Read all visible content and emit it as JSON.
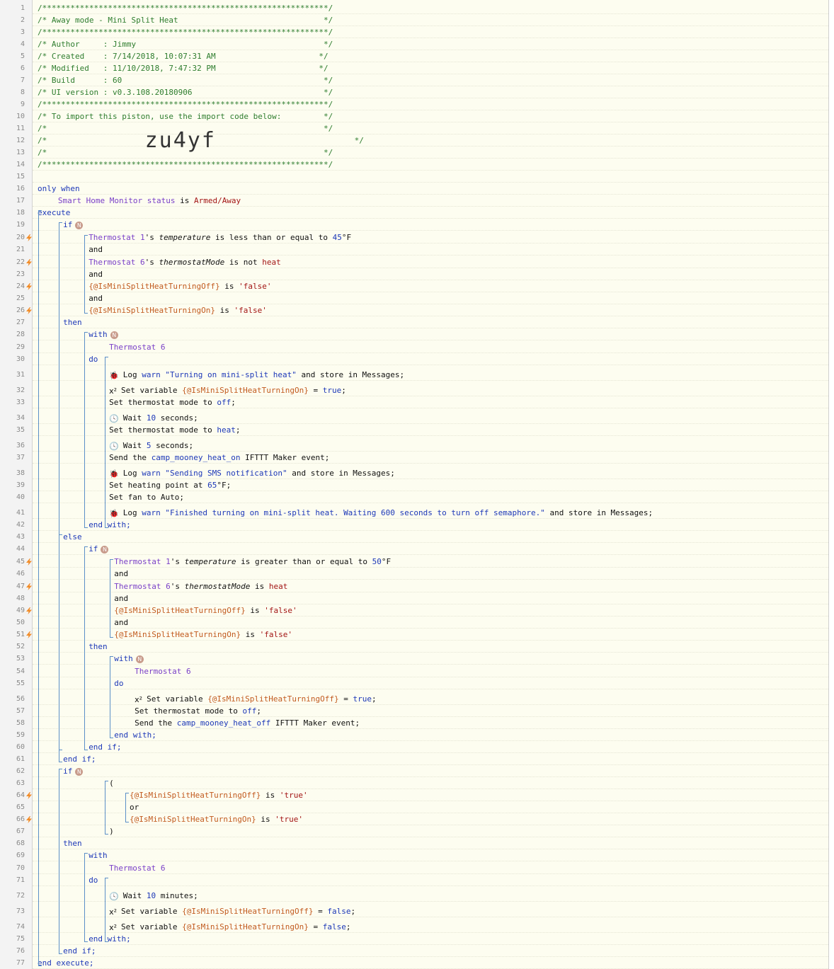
{
  "header": {
    "stars": "/*************************************************************/",
    "title": "/* Away mode - Mini Split Heat                               */",
    "author": "/* Author     : Jimmy                                        */",
    "created": "/* Created    : 7/14/2018, 10:07:31 AM                      */",
    "modified": "/* Modified   : 11/10/2018, 7:47:32 PM                      */",
    "build": "/* Build      : 60                                           */",
    "ui_version": "/* UI version : v0.3.108.20180906                            */",
    "import_text": "/* To import this piston, use the import code below:         */",
    "blank": "/*                                                           */",
    "left_cmt": "/*",
    "right_cmt": "*/",
    "import_code": "zu4yf"
  },
  "line_numbers": [
    "1",
    "2",
    "3",
    "4",
    "5",
    "6",
    "7",
    "8",
    "9",
    "10",
    "11",
    "12",
    "13",
    "14",
    "15",
    "16",
    "17",
    "18",
    "19",
    "20",
    "21",
    "22",
    "23",
    "24",
    "25",
    "26",
    "27",
    "28",
    "29",
    "30",
    "31",
    "32",
    "33",
    "34",
    "35",
    "36",
    "37",
    "38",
    "39",
    "40",
    "41",
    "42",
    "43",
    "44",
    "45",
    "46",
    "47",
    "48",
    "49",
    "50",
    "51",
    "52",
    "53",
    "54",
    "55",
    "56",
    "57",
    "58",
    "59",
    "60",
    "61",
    "62",
    "63",
    "64",
    "65",
    "66",
    "67",
    "68",
    "69",
    "70",
    "71",
    "72",
    "73",
    "74",
    "75",
    "76",
    "77"
  ],
  "kw": {
    "only_when": "only when",
    "execute": "execute",
    "if": "if",
    "then": "then",
    "with": "with",
    "do": "do",
    "else": "else",
    "and": "and",
    "or": "or",
    "end_with": "end with;",
    "end_if": "end if;",
    "end_execute": "end execute;",
    "badge": "N",
    "lparen": "(",
    "rparen": ")"
  },
  "s17": {
    "dev": "Smart Home Monitor status",
    "is": " is ",
    "val": "Armed/Away"
  },
  "s20": {
    "dev": "Thermostat 1",
    "a": "'s ",
    "attr": "temperature",
    "b": " is less than or equal to ",
    "num": "45",
    "unit": "°F"
  },
  "s22": {
    "dev": "Thermostat 6",
    "a": "'s ",
    "attr": "thermostatMode",
    "b": " is not ",
    "val": "heat"
  },
  "s24": {
    "var": "{@IsMiniSplitHeatTurningOff}",
    "b": " is ",
    "val": "'false'"
  },
  "s26": {
    "var": "{@IsMiniSplitHeatTurningOn}",
    "b": " is ",
    "val": "'false'"
  },
  "s29": {
    "dev": "Thermostat 6"
  },
  "s31": {
    "a": "Log ",
    "lvl": "warn",
    "b": " ",
    "str": "\"Turning on mini-split heat\"",
    "c": " and store in Messages;"
  },
  "s32": {
    "a": "Set variable ",
    "var": "{@IsMiniSplitHeatTurningOn}",
    "b": " = ",
    "val": "true",
    "c": ";"
  },
  "s33": {
    "a": "Set thermostat mode to ",
    "val": "off",
    "c": ";"
  },
  "s34": {
    "a": "Wait ",
    "num": "10",
    "c": " seconds;"
  },
  "s35": {
    "a": "Set thermostat mode to ",
    "val": "heat",
    "c": ";"
  },
  "s36": {
    "a": "Wait ",
    "num": "5",
    "c": " seconds;"
  },
  "s37": {
    "a": "Send the ",
    "val": "camp_mooney_heat_on",
    "c": " IFTTT Maker event;"
  },
  "s38": {
    "a": "Log ",
    "lvl": "warn",
    "b": " ",
    "str": "\"Sending SMS notification\"",
    "c": " and store in Messages;"
  },
  "s39": {
    "a": "Set heating point at ",
    "num": "65",
    "c": "°F;"
  },
  "s40": {
    "a": "Set fan to Auto;"
  },
  "s41": {
    "a": "Log ",
    "lvl": "warn",
    "b": " ",
    "str": "\"Finished turning on mini-split heat. Waiting 600 seconds to turn off semaphore.\"",
    "c": " and store in Messages;"
  },
  "s45": {
    "dev": "Thermostat 1",
    "a": "'s ",
    "attr": "temperature",
    "b": " is greater than or equal to ",
    "num": "50",
    "unit": "°F"
  },
  "s47": {
    "dev": "Thermostat 6",
    "a": "'s ",
    "attr": "thermostatMode",
    "b": " is ",
    "val": "heat"
  },
  "s49": {
    "var": "{@IsMiniSplitHeatTurningOff}",
    "b": " is ",
    "val": "'false'"
  },
  "s51": {
    "var": "{@IsMiniSplitHeatTurningOn}",
    "b": " is ",
    "val": "'false'"
  },
  "s54": {
    "dev": "Thermostat 6"
  },
  "s56": {
    "a": "Set variable ",
    "var": "{@IsMiniSplitHeatTurningOff}",
    "b": " = ",
    "val": "true",
    "c": ";"
  },
  "s57": {
    "a": "Set thermostat mode to ",
    "val": "off",
    "c": ";"
  },
  "s58": {
    "a": "Send the ",
    "val": "camp_mooney_heat_off",
    "c": " IFTTT Maker event;"
  },
  "s64": {
    "var": "{@IsMiniSplitHeatTurningOff}",
    "b": " is ",
    "val": "'true'"
  },
  "s66": {
    "var": "{@IsMiniSplitHeatTurningOn}",
    "b": " is ",
    "val": "'true'"
  },
  "s70": {
    "dev": "Thermostat 6"
  },
  "s72": {
    "a": "Wait ",
    "num": "10",
    "c": " minutes;"
  },
  "s73": {
    "a": "Set variable ",
    "var": "{@IsMiniSplitHeatTurningOff}",
    "b": " = ",
    "val": "false",
    "c": ";"
  },
  "s74": {
    "a": "Set variable ",
    "var": "{@IsMiniSplitHeatTurningOn}",
    "b": " = ",
    "val": "false",
    "c": ";"
  },
  "icons": {
    "log": "bug-icon",
    "var": "variable-icon",
    "wait": "clock-icon",
    "trigger": "lightning-bolt-icon"
  },
  "colors": {
    "keyword": "#1d38b8",
    "device": "#7a40c8",
    "value": "#a31515",
    "variable": "#c25b20",
    "comment": "#2e7d2e",
    "trigger": "#f28c28"
  }
}
